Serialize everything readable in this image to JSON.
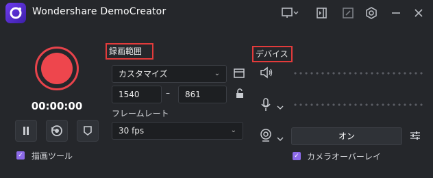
{
  "app": {
    "title": "Wondershare DemoCreator"
  },
  "recording": {
    "timer": "00:00:00",
    "draw_tool_label": "描画ツール"
  },
  "area": {
    "section_label": "録画範囲",
    "mode_value": "カスタマイズ",
    "width_value": "1540",
    "height_value": "861",
    "separator": "–",
    "framerate_label": "フレームレート",
    "framerate_value": "30 fps"
  },
  "devices": {
    "section_label": "デバイス",
    "camera_toggle_label": "オン",
    "camera_overlay_label": "カメラオーバーレイ"
  },
  "icons": {
    "titlebar": [
      "display-dropdown-icon",
      "panel-icon",
      "resize-icon",
      "settings-gear-icon",
      "minimize-icon",
      "close-icon"
    ]
  },
  "colors": {
    "record_red": "#ee464d",
    "accent_purple": "#8c6ae8",
    "highlight_box": "#e33b3b"
  }
}
